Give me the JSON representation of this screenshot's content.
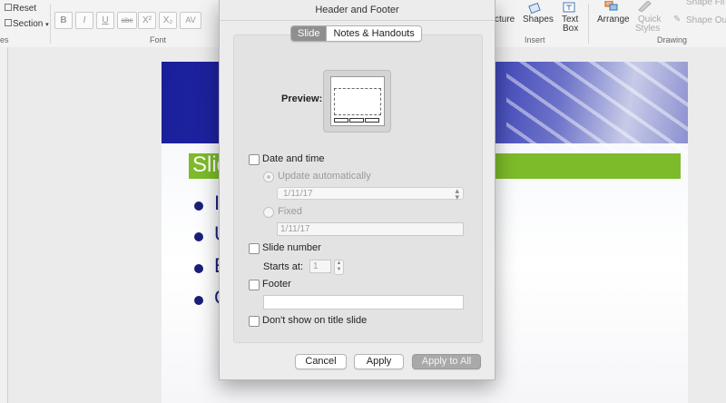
{
  "ribbon": {
    "reset_label": "Reset",
    "section_label": "Section",
    "slides_group_partial": "es",
    "font_group_label": "Font",
    "picture_partial": "cture",
    "shapes_label": "Shapes",
    "textbox_label_1": "Text",
    "textbox_label_2": "Box",
    "insert_group_label": "Insert",
    "arrange_label": "Arrange",
    "quick_styles_label_1": "Quick",
    "quick_styles_label_2": "Styles",
    "shape_fill_partial": "Shape Fil",
    "shape_outline_partial": "Shape Outl",
    "drawing_group_label": "Drawing",
    "format_buttons": [
      "B",
      "I",
      "U",
      "abc",
      "X²",
      "X₂",
      "AV"
    ]
  },
  "slide": {
    "title_partial": "Slid",
    "bullets_partial": [
      "I",
      "U",
      "E",
      "C"
    ]
  },
  "dialog": {
    "title": "Header and Footer",
    "tabs": [
      {
        "label": "Slide",
        "active": true
      },
      {
        "label": "Notes & Handouts",
        "active": false
      }
    ],
    "preview_label": "Preview:",
    "date_time": {
      "label": "Date and time",
      "checked": false,
      "update_auto_label": "Update automatically",
      "update_auto_value": "1/11/17",
      "fixed_label": "Fixed",
      "fixed_value": "1/11/17"
    },
    "slide_number": {
      "label": "Slide number",
      "checked": false,
      "starts_at_label": "Starts at:",
      "starts_at_value": "1"
    },
    "footer": {
      "label": "Footer",
      "checked": false,
      "value": ""
    },
    "dont_show_title": {
      "label": "Don't show on title slide",
      "checked": false
    },
    "buttons": {
      "cancel": "Cancel",
      "apply": "Apply",
      "apply_all": "Apply to All"
    }
  },
  "colors": {
    "slide_banner": "#2830b0",
    "slide_title_bar": "#7dbb2b",
    "bullet_text": "#1b1f7a",
    "segment_active": "#8f8f8f"
  }
}
